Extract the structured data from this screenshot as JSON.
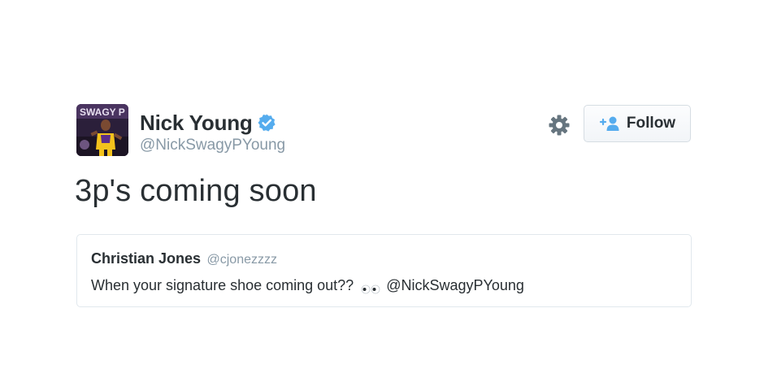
{
  "tweet": {
    "author": {
      "display_name": "Nick Young",
      "handle": "@NickSwagyPYoung",
      "verified": true,
      "avatar_icon": "avatar-photo",
      "avatar_text": "SWAGY P"
    },
    "text": "3p's coming soon",
    "actions": {
      "settings_icon": "gear-icon",
      "follow_label": "Follow",
      "follow_icon": "add-user-icon"
    },
    "quoted": {
      "author_name": "Christian Jones",
      "author_handle": "@cjonezzzz",
      "text_before": "When your signature shoe coming out??",
      "emoji_icon": "eyes-icon",
      "mention": "@NickSwagyPYoung"
    }
  },
  "colors": {
    "text": "#292f33",
    "secondary_text": "#8899a6",
    "verified_blue": "#55acee",
    "border": "#e1e8ed"
  }
}
